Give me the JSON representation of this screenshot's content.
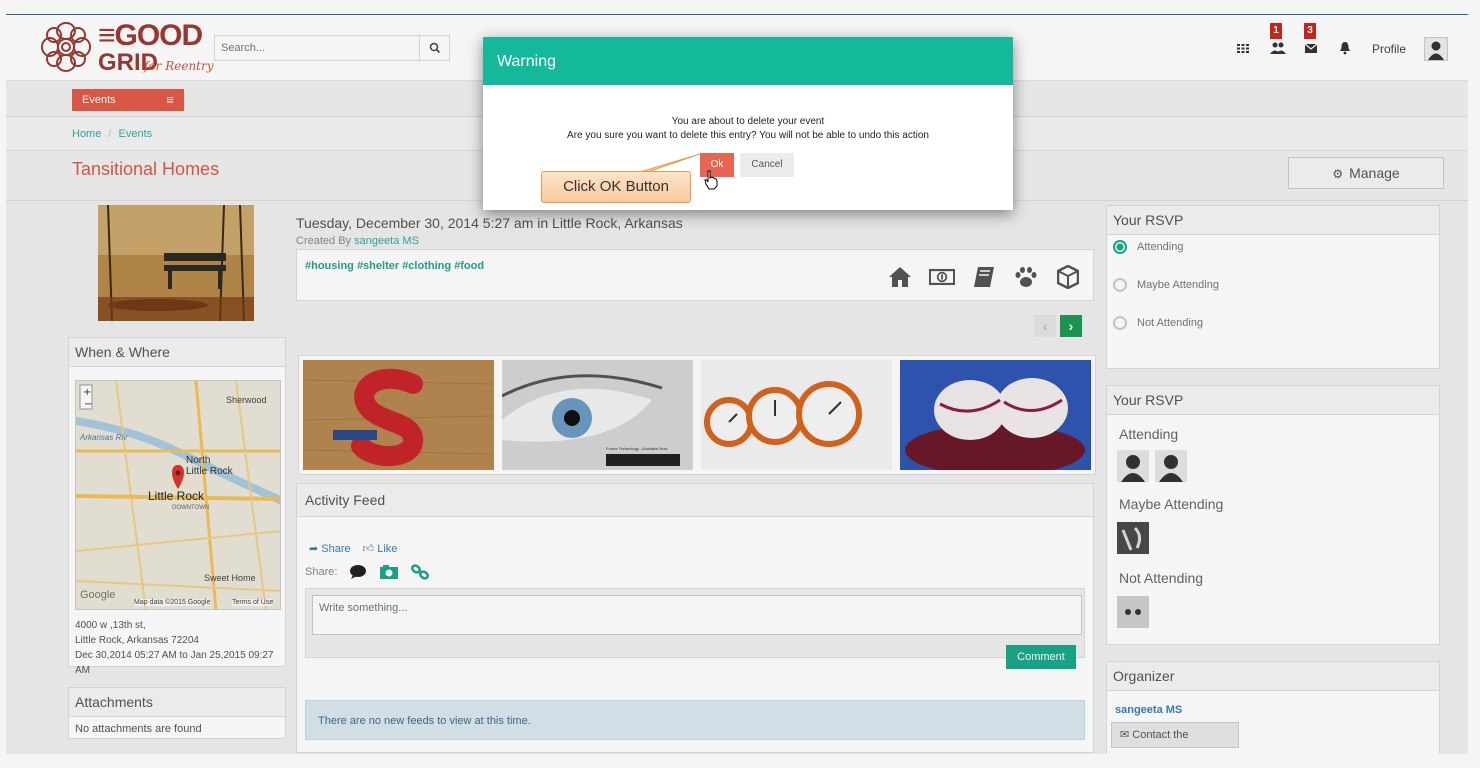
{
  "header": {
    "logo_line1": "≡GOOD",
    "logo_line2": "GRID",
    "logo_sub": "for Reentry",
    "search_placeholder": "Search...",
    "badges": [
      "1",
      "3"
    ],
    "profile_label": "Profile"
  },
  "subnav": {
    "events_label": "Events"
  },
  "breadcrumb": {
    "home": "Home",
    "sep": "/",
    "current": "Events"
  },
  "page": {
    "title": "Tansitional Homes",
    "manage_label": "Manage"
  },
  "event": {
    "datetime": "Tuesday, December 30, 2014 5:27 am in Little Rock, Arkansas",
    "created_by_prefix": "Created By",
    "created_by_name": "sangeeta MS",
    "tags": "#housing #shelter #clothing #food",
    "category_icons": [
      "home-icon",
      "money-icon",
      "book-icon",
      "paw-icon",
      "cube-icon"
    ]
  },
  "when_where": {
    "heading": "When & Where",
    "map_labels": {
      "sherwood": "Sherwood",
      "north_little_rock": "North\nLittle Rock",
      "little_rock": "Little Rock",
      "downtown": "DOWNTOWN",
      "sweet_home": "Sweet Home",
      "google": "Google",
      "map_data": "Map data ©2015 Google",
      "terms": "Terms of Use",
      "arkansas_river": "Arkansas Riv"
    },
    "address_line1": "4000 w ,13th st,",
    "address_line2": "Little Rock, Arkansas 72204",
    "dates": "Dec 30,2014 05:27 AM to Jan 25,2015 09:27 AM"
  },
  "attachments": {
    "heading": "Attachments",
    "empty": "No attachments are found"
  },
  "activity": {
    "heading": "Activity Feed",
    "share_label": "Share",
    "like_label": "Like",
    "share_prefix": "Share:",
    "placeholder": "Write something...",
    "comment_label": "Comment",
    "no_feeds": "There are no new feeds to view at this time."
  },
  "rsvp_form": {
    "heading": "Your RSVP",
    "options": [
      {
        "label": "Attending",
        "selected": true
      },
      {
        "label": "Maybe Attending",
        "selected": false
      },
      {
        "label": "Not Attending",
        "selected": false
      }
    ]
  },
  "rsvp_list": {
    "heading": "Your RSVP",
    "attending_label": "Attending",
    "maybe_label": "Maybe Attending",
    "not_label": "Not Attending"
  },
  "organizer": {
    "heading": "Organizer",
    "name": "sangeeta MS",
    "contact_label": "Contact the Organizer"
  },
  "modal": {
    "title": "Warning",
    "line1": "You are about to delete your event",
    "line2": "Are you sure you want to delete this entry? You will not be able to undo this action",
    "ok_label": "Ok",
    "cancel_label": "Cancel"
  },
  "callout": {
    "text": "Click OK Button"
  },
  "thumb_captions": {
    "radeon": "Future Technology - Available Now"
  },
  "colors": {
    "teal": "#14b89a",
    "accent_red": "#e05a47",
    "link_blue": "#3a7fb7",
    "tag_green": "#28a08f"
  }
}
